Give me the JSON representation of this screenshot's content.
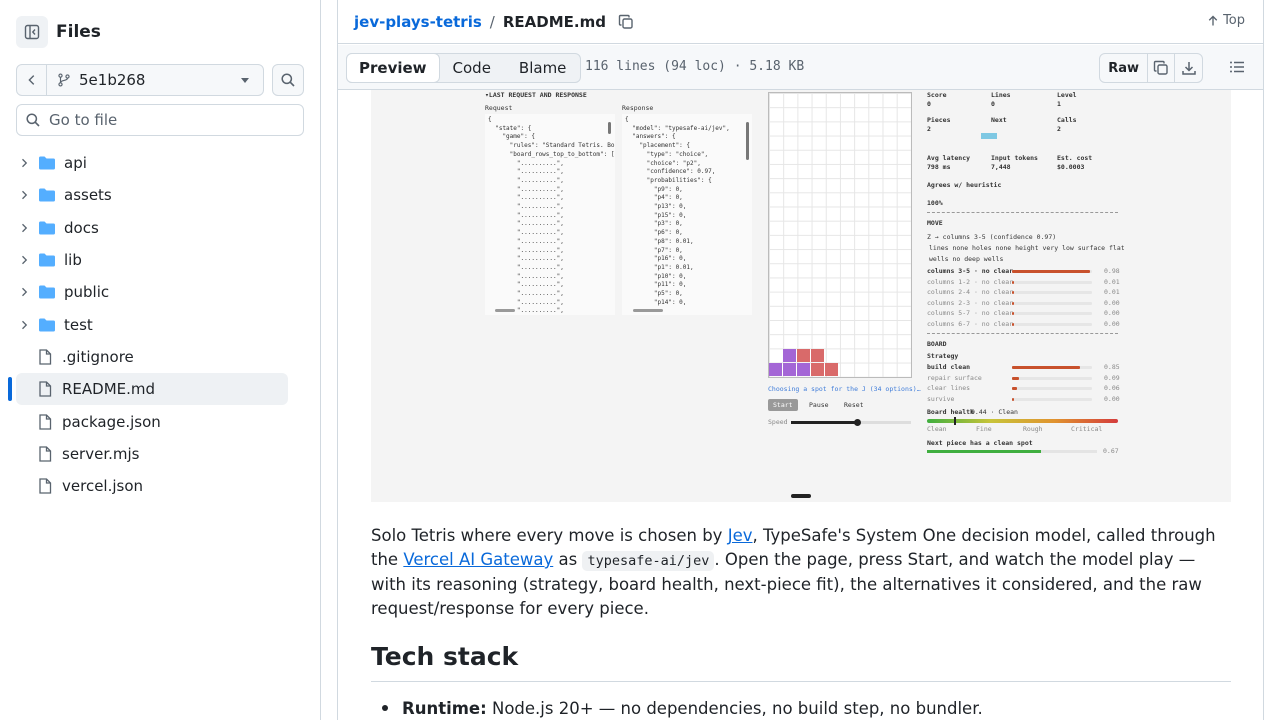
{
  "sidebar": {
    "title": "Files",
    "branch": "5e1b268",
    "goto_placeholder": "Go to file",
    "folders": [
      "api",
      "assets",
      "docs",
      "lib",
      "public",
      "test"
    ],
    "files": [
      ".gitignore",
      "README.md",
      "package.json",
      "server.mjs",
      "vercel.json"
    ],
    "active_file": "README.md"
  },
  "header": {
    "repo": "jev-plays-tetris",
    "separator": "/",
    "file": "README.md",
    "top_label": "Top"
  },
  "toolbar": {
    "tabs": [
      "Preview",
      "Code",
      "Blame"
    ],
    "active_tab": "Preview",
    "file_info": "116 lines (94 loc) · 5.18 KB",
    "raw_label": "Raw"
  },
  "screenshot": {
    "section_title": "▾LAST REQUEST AND RESPONSE",
    "request_label": "Request",
    "response_label": "Response",
    "request_text": "{\n  \"state\": {\n    \"game\": {\n      \"rules\": \"Standard Tetris. Bo\n      \"board_rows_top_to_bottom\": [\n        \"..........\",\n        \"..........\",\n        \"..........\",\n        \"..........\",\n        \"..........\",\n        \"..........\",\n        \"..........\",\n        \"..........\",\n        \"..........\",\n        \"..........\",\n        \"..........\",\n        \"..........\",\n        \"..........\",\n        \"..........\",\n        \"..........\",\n        \"..........\",\n        \"..........\",\n        \"..........\",\n        \"..........\",\n        \"..........\",\n        \"..........\",",
    "response_text": "{\n  \"model\": \"typesafe-ai/jev\",\n  \"answers\": {\n    \"placement\": {\n      \"type\": \"choice\",\n      \"choice\": \"p2\",\n      \"confidence\": 0.97,\n      \"probabilities\": {\n        \"p9\": 0,\n        \"p4\": 0,\n        \"p13\": 0,\n        \"p15\": 0,\n        \"p3\": 0,\n        \"p6\": 0,\n        \"p8\": 0.01,\n        \"p7\": 0,\n        \"p16\": 0,\n        \"p1\": 0.01,\n        \"p10\": 0,\n        \"p11\": 0,\n        \"p5\": 0,\n        \"p14\": 0,",
    "caption": "Choosing a spot for the J (34 options)…",
    "buttons": [
      "Start",
      "Pause",
      "Reset"
    ],
    "speed_label": "Speed",
    "speed_value": 0.55,
    "stats": [
      {
        "label": "Score",
        "value": "0"
      },
      {
        "label": "Lines",
        "value": "0"
      },
      {
        "label": "Level",
        "value": "1"
      },
      {
        "label": "Pieces",
        "value": "2"
      },
      {
        "label": "Next",
        "value": ""
      },
      {
        "label": "Calls",
        "value": "2"
      },
      {
        "label": "Avg latency",
        "value": "798 ms"
      },
      {
        "label": "Input tokens",
        "value": "7,448"
      },
      {
        "label": "Est. cost",
        "value": "$0.0003"
      }
    ],
    "agrees_label": "Agrees w/ heuristic",
    "agrees_value": "100%",
    "move_title": "MOVE",
    "move_line": "Z → columns 3-5 (confidence 0.97)",
    "move_tags": "lines none  holes none  height very low  surface flat",
    "move_tags2": "wells no deep wells",
    "options": [
      {
        "label": "columns 3-5 · no clear…",
        "value": 0.98,
        "text": "0.98"
      },
      {
        "label": "columns 1-2 · no clear…",
        "value": 0.01,
        "text": "0.01"
      },
      {
        "label": "columns 2-4 · no clear…",
        "value": 0.01,
        "text": "0.01"
      },
      {
        "label": "columns 2-3 · no clear…",
        "value": 0.0,
        "text": "0.00"
      },
      {
        "label": "columns 5-7 · no clear…",
        "value": 0.0,
        "text": "0.00"
      },
      {
        "label": "columns 6-7 · no clear…",
        "value": 0.0,
        "text": "0.00"
      }
    ],
    "board_title": "BOARD",
    "strategy_label": "Strategy",
    "strategies": [
      {
        "label": "build clean",
        "value": 0.85,
        "text": "0.85"
      },
      {
        "label": "repair surface",
        "value": 0.09,
        "text": "0.09"
      },
      {
        "label": "clear lines",
        "value": 0.06,
        "text": "0.06"
      },
      {
        "label": "survive",
        "value": 0.0,
        "text": "0.00"
      }
    ],
    "health_label": "Board health",
    "health_value_text": "0.44 · Clean",
    "health_value": 0.14,
    "health_scale": [
      "Clean",
      "Fine",
      "Rough",
      "Critical"
    ],
    "next_fit_label": "Next piece has a clean spot",
    "next_fit_value": 0.67,
    "next_fit_text": "0.67",
    "colors": {
      "bar": "#c8512c",
      "piece_purple": "#a466d6",
      "piece_red": "#d96a6a",
      "link": "#0969da"
    }
  },
  "readme": {
    "p_text1": "Solo Tetris where every move is chosen by ",
    "p_link1": "Jev",
    "p_text2": ", TypeSafe's System One decision model, called through the ",
    "p_link2": "Vercel AI Gateway",
    "p_text3": " as ",
    "p_code": "typesafe-ai/jev",
    "p_text4": ". Open the page, press Start, and watch the model play — with its reasoning (strategy, board health, next-piece fit), the alternatives it considered, and the raw request/response for every piece.",
    "h2": "Tech stack",
    "li_bold": "Runtime:",
    "li_text": " Node.js 20+ — no dependencies, no build step, no bundler."
  }
}
